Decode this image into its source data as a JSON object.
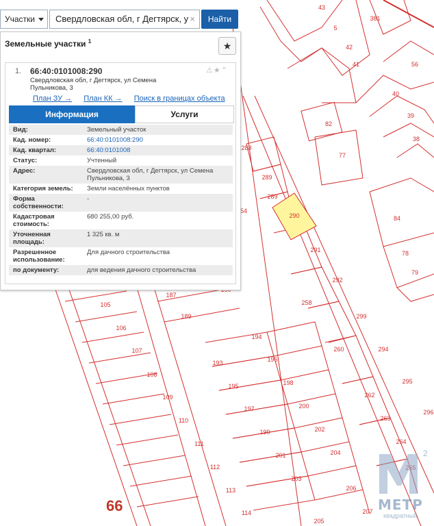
{
  "search": {
    "mode": "Участки",
    "query": "Свердловская обл, г Дегтярск, у",
    "clear_glyph": "×",
    "button": "Найти"
  },
  "panel": {
    "title": "Земельные участки",
    "count": "1",
    "favorite_glyph": "★"
  },
  "result": {
    "index": "1.",
    "cadastral_number": "66:40:0101008:290",
    "address": "Свердловская обл, г Дегтярск, ул Семена Пульникова, 3",
    "icons": "⚠★⌃",
    "links": [
      "План ЗУ →",
      "План КК →",
      "Поиск в границах объекта →"
    ],
    "tabs": {
      "info": "Информация",
      "services": "Услуги"
    },
    "properties": [
      {
        "key": "Вид:",
        "value": "Земельный участок"
      },
      {
        "key": "Кад. номер:",
        "value": "66:40:0101008:290",
        "link": true
      },
      {
        "key": "Кад. квартал:",
        "value": "66:40:0101008",
        "link": true
      },
      {
        "key": "Статус:",
        "value": "Учтенный"
      },
      {
        "key": "Адрес:",
        "value": "Свердловская обл, г Дегтярск, ул Семена Пульникова, 3"
      },
      {
        "key": "Категория земель:",
        "value": "Земли населённых пунктов"
      },
      {
        "key": "Форма собственности:",
        "value": "-"
      },
      {
        "key": "Кадастровая стоимость:",
        "value": "680 255,00 руб."
      },
      {
        "key": "Уточненная площадь:",
        "value": "1 325 кв. м"
      },
      {
        "key": "Разрешенное использование:",
        "value": "Для дачного строительства"
      },
      {
        "key": "по документу:",
        "value": "для ведения дачного строительства"
      }
    ]
  },
  "map": {
    "highlight_color": "#fff59d",
    "line_color": "#d32f2f",
    "parcel_labels": [
      "43",
      "5",
      "42",
      "41",
      "381",
      "56",
      "40",
      "39",
      "38",
      "82",
      "77",
      "288",
      "289",
      "289",
      "290",
      "54",
      "84",
      "291",
      "78",
      "79",
      "292",
      "258",
      "299",
      "187",
      "190",
      "189",
      "105",
      "106",
      "107",
      "108",
      "109",
      "110",
      "111",
      "112",
      "113",
      "114",
      "194",
      "193",
      "196",
      "195",
      "198",
      "197",
      "200",
      "199",
      "202",
      "201",
      "204",
      "203",
      "206",
      "205",
      "207",
      "260",
      "294",
      "295",
      "262",
      "263",
      "264",
      "265",
      "296"
    ],
    "zone_label": "66"
  },
  "logo": {
    "word": "МЕТР",
    "sub": "квадратный",
    "sup": "2"
  }
}
